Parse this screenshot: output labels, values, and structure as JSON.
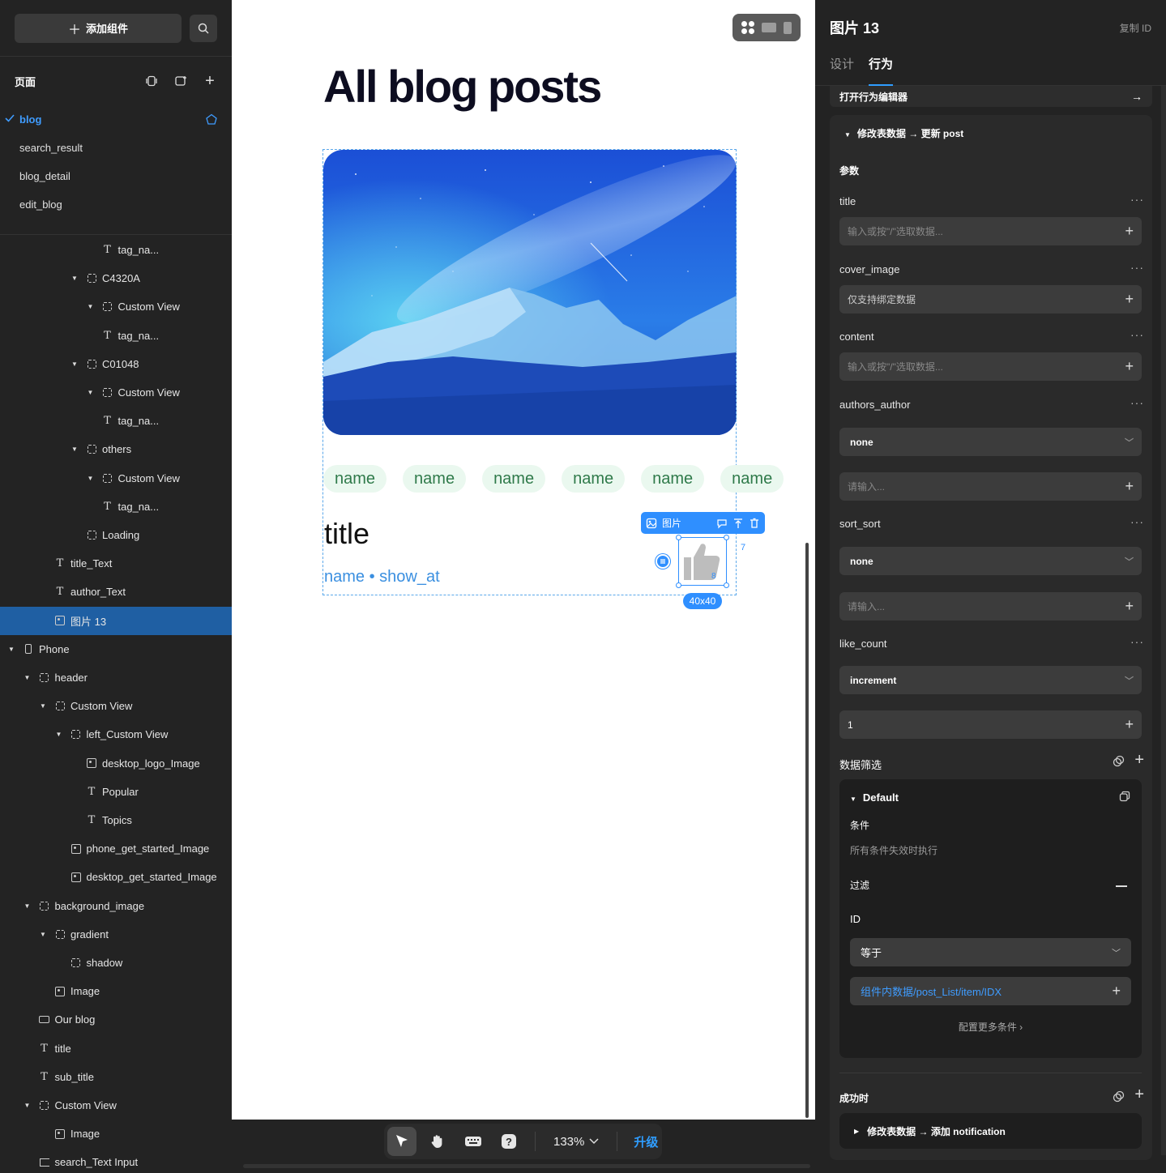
{
  "left": {
    "add_component": "添加组件",
    "pages_title": "页面",
    "pages": [
      "blog",
      "search_result",
      "blog_detail",
      "edit_blog"
    ],
    "tree": [
      {
        "label": "tag_na...",
        "type": "text",
        "indent": 5,
        "open": null
      },
      {
        "label": "C4320A",
        "type": "box",
        "indent": 4,
        "open": true
      },
      {
        "label": "Custom View",
        "type": "box",
        "indent": 5,
        "open": true
      },
      {
        "label": "tag_na...",
        "type": "text",
        "indent": 5,
        "open": null
      },
      {
        "label": "C01048",
        "type": "box",
        "indent": 4,
        "open": true
      },
      {
        "label": "Custom View",
        "type": "box",
        "indent": 5,
        "open": true
      },
      {
        "label": "tag_na...",
        "type": "text",
        "indent": 5,
        "open": null
      },
      {
        "label": "others",
        "type": "box",
        "indent": 4,
        "open": true
      },
      {
        "label": "Custom View",
        "type": "box",
        "indent": 5,
        "open": true
      },
      {
        "label": "tag_na...",
        "type": "text",
        "indent": 5,
        "open": null
      },
      {
        "label": "Loading",
        "type": "box",
        "indent": 4,
        "open": null
      },
      {
        "label": "title_Text",
        "type": "text",
        "indent": 2,
        "open": null
      },
      {
        "label": "author_Text",
        "type": "text",
        "indent": 2,
        "open": null
      },
      {
        "label": "图片 13",
        "type": "img",
        "indent": 2,
        "open": null,
        "selected": true
      },
      {
        "label": "Phone",
        "type": "phone",
        "indent": 0,
        "open": true
      },
      {
        "label": "header",
        "type": "box",
        "indent": 1,
        "open": true
      },
      {
        "label": "Custom View",
        "type": "box",
        "indent": 2,
        "open": true
      },
      {
        "label": "left_Custom View",
        "type": "box",
        "indent": 3,
        "open": true
      },
      {
        "label": "desktop_logo_Image",
        "type": "img",
        "indent": 4,
        "open": null
      },
      {
        "label": "Popular",
        "type": "text",
        "indent": 4,
        "open": null
      },
      {
        "label": "Topics",
        "type": "text",
        "indent": 4,
        "open": null
      },
      {
        "label": "phone_get_started_Image",
        "type": "img",
        "indent": 3,
        "open": null
      },
      {
        "label": "desktop_get_started_Image",
        "type": "img",
        "indent": 3,
        "open": null
      },
      {
        "label": "background_image",
        "type": "box",
        "indent": 1,
        "open": true
      },
      {
        "label": "gradient",
        "type": "box",
        "indent": 2,
        "open": true
      },
      {
        "label": "shadow",
        "type": "box",
        "indent": 3,
        "open": null
      },
      {
        "label": "Image",
        "type": "img",
        "indent": 2,
        "open": null
      },
      {
        "label": "Our blog",
        "type": "btn",
        "indent": 1,
        "open": null
      },
      {
        "label": "title",
        "type": "text",
        "indent": 1,
        "open": null
      },
      {
        "label": "sub_title",
        "type": "text",
        "indent": 1,
        "open": null
      },
      {
        "label": "Custom View",
        "type": "box",
        "indent": 1,
        "open": true
      },
      {
        "label": "Image",
        "type": "img",
        "indent": 2,
        "open": null
      },
      {
        "label": "search_Text Input",
        "type": "input",
        "indent": 1,
        "open": null
      }
    ]
  },
  "canvas": {
    "heading": "All blog posts",
    "tags": [
      "name",
      "name",
      "name",
      "name",
      "name",
      "name"
    ],
    "card_title": "title",
    "card_meta": "name • show_at",
    "toolbar_label": "图片",
    "size_badge": "40x40",
    "dist_right": "7",
    "dist_bottom": "8",
    "zoom": "133%",
    "upgrade": "升级"
  },
  "right": {
    "title": "图片 13",
    "copy_id": "复制 ID",
    "tabs": [
      "设计",
      "行为"
    ],
    "open_editor": "打开行为编辑器",
    "action_title": "修改表数据 → 更新 post",
    "params_label": "参数",
    "params": {
      "title": {
        "label": "title",
        "placeholder": "输入或按\"/\"选取数据..."
      },
      "cover_image": {
        "label": "cover_image",
        "placeholder": "仅支持绑定数据"
      },
      "content": {
        "label": "content",
        "placeholder": "输入或按\"/\"选取数据..."
      },
      "authors_author": {
        "label": "authors_author",
        "select": "none",
        "placeholder": "请输入..."
      },
      "sort_sort": {
        "label": "sort_sort",
        "select": "none",
        "placeholder": "请输入..."
      },
      "like_count": {
        "label": "like_count",
        "select": "increment",
        "value": "1"
      }
    },
    "filter_label": "数据筛选",
    "filter": {
      "name": "Default",
      "condition_label": "条件",
      "condition_text": "所有条件失效时执行",
      "filter_label": "过滤",
      "field": "ID",
      "operator": "等于",
      "value": "组件内数据/post_List/item/IDX",
      "more": "配置更多条件"
    },
    "success_label": "成功时",
    "success_action": "修改表数据 → 添加 notification"
  },
  "colors": {
    "accent": "#2f8fff",
    "tag_bg": "#eaf8ef",
    "tag_text": "#2f7a4a",
    "selected_row": "#1f5fa3"
  }
}
